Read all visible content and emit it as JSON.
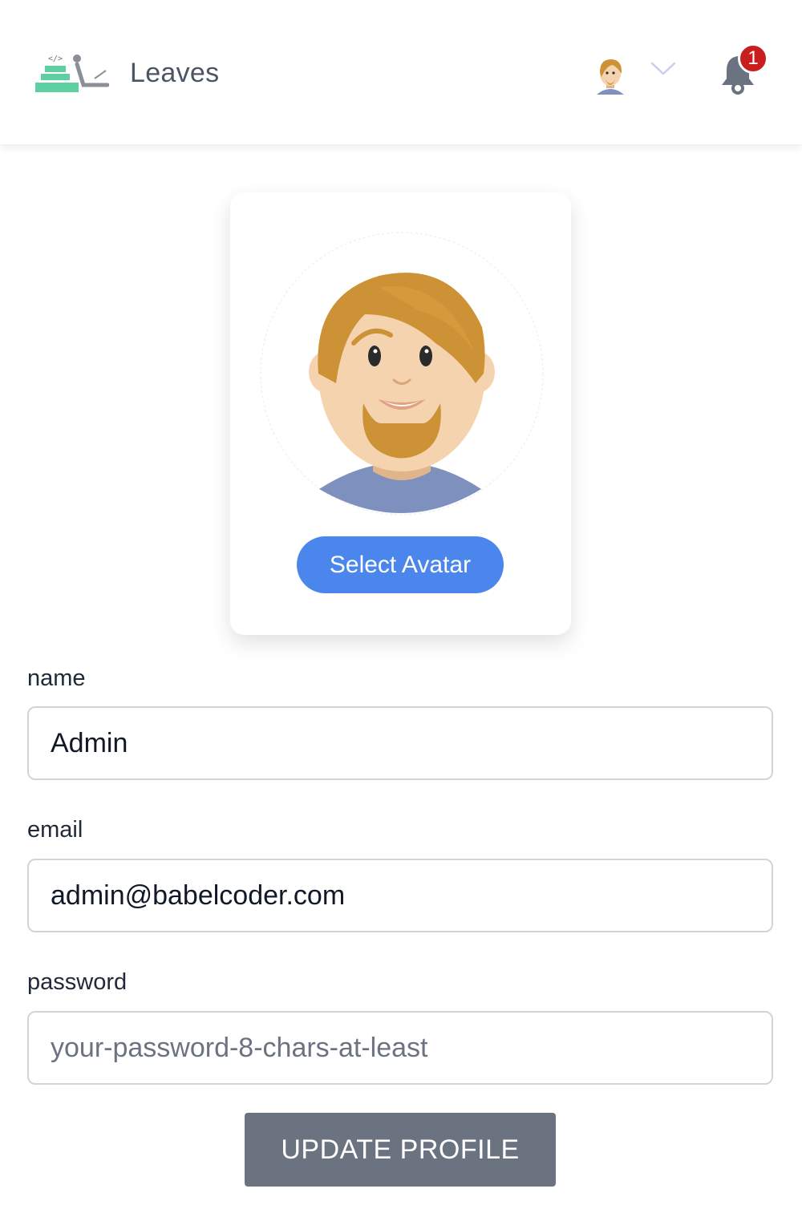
{
  "header": {
    "brand": "Leaves",
    "notifications_count": "1"
  },
  "profile": {
    "select_avatar_label": "Select Avatar"
  },
  "form": {
    "name_label": "name",
    "name_value": "Admin",
    "email_label": "email",
    "email_value": "admin@babelcoder.com",
    "password_label": "password",
    "password_placeholder": "your-password-8-chars-at-least",
    "submit_label": "UPDATE PROFILE"
  },
  "icons": {
    "logo": "leaves-logo-icon",
    "user_avatar": "user-avatar-icon",
    "menu_toggle": "chevron-down-icon",
    "notifications": "bell-icon"
  },
  "colors": {
    "primary_button": "#4a86ec",
    "submit_button": "#6b7280",
    "badge": "#c81e1e",
    "logo_green": "#5dcfa0",
    "hair": "#cd9235",
    "skin": "#f5d3ae",
    "shirt": "#7e90be"
  }
}
